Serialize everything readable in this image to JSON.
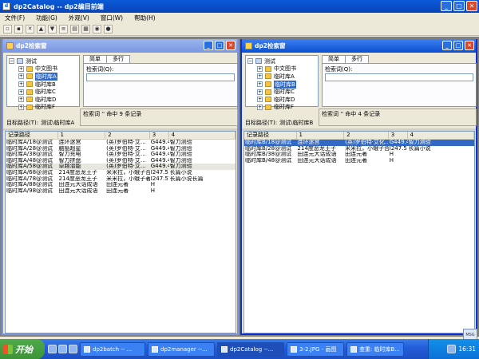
{
  "app": {
    "title": "dp2Catalog -- dp2编目前端",
    "icon": "dp2-app-icon"
  },
  "menu": [
    "文件(F)",
    "功能(G)",
    "外观(V)",
    "窗口(W)",
    "帮助(H)"
  ],
  "toolbar": {
    "icons": [
      "new-icon",
      "save-icon",
      "delete-icon",
      "up-icon",
      "down-icon",
      "list-icon",
      "detail-icon",
      "form-icon",
      "search-icon",
      "stop-icon"
    ]
  },
  "left": {
    "title": "dp2检索窗",
    "tree": {
      "root": "测试",
      "nodes": [
        "中文图书",
        "临时库A",
        "临时库B",
        "临时库C",
        "临时库D",
        "临时库F"
      ],
      "selected": "临时库A"
    },
    "tabs": [
      "简单",
      "多行"
    ],
    "query_label": "检索词(Q):",
    "query_value": "",
    "result": "检索词 '' 命中 9 条记录",
    "target_label": "目标路径(T):",
    "target_value": "测试\\临时库A",
    "columns": [
      "记录路径",
      "1",
      "2",
      "3",
      "4"
    ],
    "rows": [
      [
        "临时库A/18@测试",
        "连环迷宫",
        "(英)罗伯特·艾…",
        "G449.4",
        "智力测验"
      ],
      [
        "临时库A/28@测试",
        "脑筋超星",
        "(英)罗伯特·艾…",
        "G449.4",
        "智力测验"
      ],
      [
        "临时库A/38@测试",
        "智力充电",
        "(英)罗伯特·艾…",
        "G449.4",
        "智力测验"
      ],
      [
        "临时库A/48@测试",
        "智力拼盘",
        "(英)罗伯特·艾…",
        "G449.4",
        "智力测验"
      ],
      [
        "临时库A/58@测试",
        "卓越潜能",
        "(英)罗伯特·艾…",
        "G449.4",
        "智力测验"
      ],
      [
        "临时库A/68@测试",
        "214度恶龙王子",
        "米米拉，小蛾子合著",
        "I247.5",
        "长篇小说"
      ],
      [
        "临时库A/78@测试",
        "214度恶龙王子",
        "米米拉，小蛾子著",
        "I247.57",
        "长篇小说长篇"
      ],
      [
        "临时库A/88@测试",
        "田连元大话成语",
        "田连元著",
        "H",
        ""
      ],
      [
        "临时库A/98@测试",
        "田连元大话成语",
        "田连元著",
        "H",
        ""
      ]
    ],
    "highlighted_row": 4
  },
  "right": {
    "title": "dp2检索窗",
    "tree": {
      "root": "测试",
      "nodes": [
        "中文图书",
        "临时库A",
        "临时库B",
        "临时库C",
        "临时库D",
        "临时库F"
      ],
      "selected": "临时库B"
    },
    "tabs": [
      "简单",
      "多行"
    ],
    "query_label": "检索词(Q):",
    "query_value": "",
    "result": "检索词 '' 命中 4 条记录",
    "target_label": "目标路径(T):",
    "target_value": "测试\\临时库B",
    "columns": [
      "记录路径",
      "1",
      "2",
      "3",
      "4"
    ],
    "rows": [
      [
        "临时库B/18@测试",
        "连环迷宫",
        "(英)罗伯特·艾化…",
        "G449.4",
        "智力测验"
      ],
      [
        "临时库B/28@测试",
        "214度恶龙王子",
        "米米拉，小蛾子合著",
        "I247.5",
        "长篇小说"
      ],
      [
        "临时库B/38@测试",
        "田连元大话成语",
        "田连元著",
        "H",
        ""
      ],
      [
        "临时库B/48@测试",
        "田连元大话成语",
        "田连元著",
        "H",
        ""
      ]
    ],
    "selected_row": 0
  },
  "taskbar": {
    "start": "开始",
    "tasks": [
      "dp2batch -- ...",
      "dp2manager --...",
      "dp2Catalog --...",
      "3-2.JPG - 画图",
      "查重: 临时库B..."
    ],
    "active_task": 2,
    "clock": "16:31"
  },
  "msg_badge": "MSG"
}
